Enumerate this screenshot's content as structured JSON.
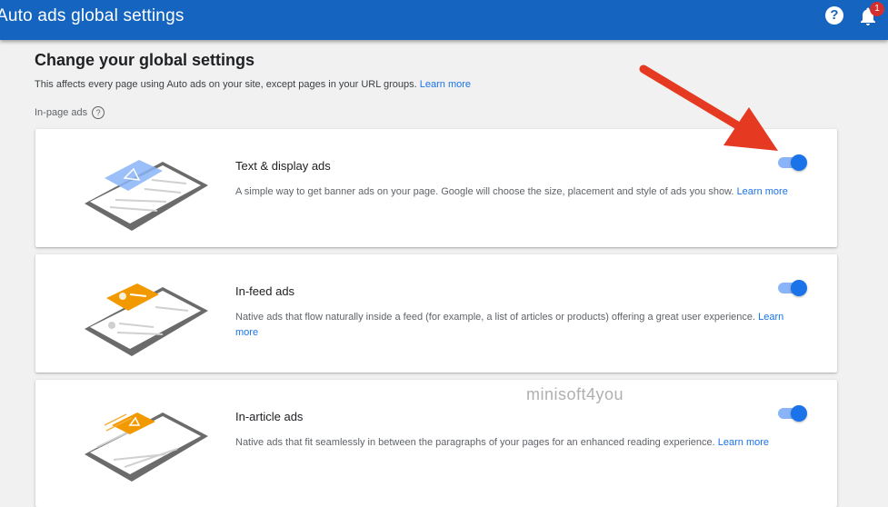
{
  "header": {
    "title": "Auto ads global settings",
    "help_icon": "?",
    "notification_count": "1"
  },
  "main": {
    "heading": "Change your global settings",
    "description": "This affects every page using Auto ads on your site, except pages in your URL groups.",
    "learn_more": "Learn more",
    "section_label": "In-page ads",
    "section_help_icon": "?"
  },
  "cards": [
    {
      "title": "Text & display ads",
      "description": "A simple way to get banner ads on your page. Google will choose the size, placement and style of ads you show.",
      "learn_more": "Learn more",
      "enabled": true
    },
    {
      "title": "In-feed ads",
      "description": "Native ads that flow naturally inside a feed (for example, a list of articles or products) offering a great user experience.",
      "learn_more": "Learn more",
      "enabled": true
    },
    {
      "title": "In-article ads",
      "description": "Native ads that fit seamlessly in between the paragraphs of your pages for an enhanced reading experience.",
      "learn_more": "Learn more",
      "enabled": true
    }
  ],
  "watermark": "minisoft4you",
  "colors": {
    "topbar": "#1565c0",
    "accent": "#1a73e8",
    "arrow": "#e53922",
    "ad_blue": "#8ab4f8",
    "ad_orange": "#f29900"
  }
}
